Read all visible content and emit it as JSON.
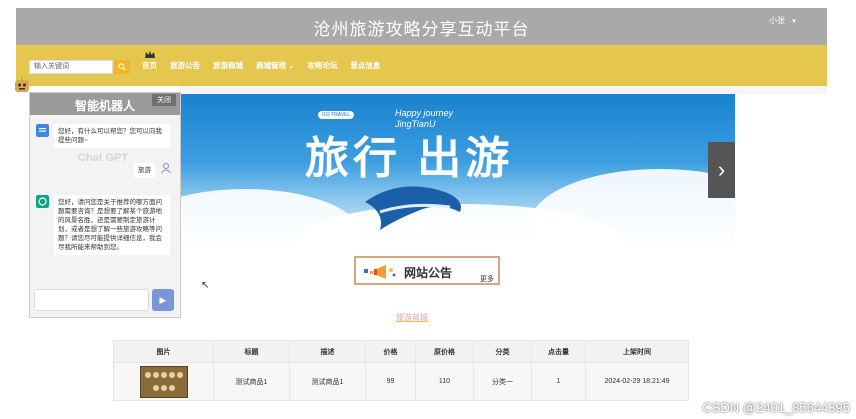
{
  "header": {
    "title": "沧州旅游攻略分享互动平台",
    "user": "小张"
  },
  "search": {
    "placeholder": "输入关键词"
  },
  "nav": {
    "items": [
      "首页",
      "旅游公告",
      "旅游商城",
      "商城管理",
      "攻略论坛",
      "景点信息"
    ]
  },
  "banner": {
    "slogan": "旅行 出游",
    "english": "Happy journey\nJingTianU",
    "tag": "GO TRAVEL"
  },
  "announcement": {
    "label": "网站公告",
    "more": "更多"
  },
  "section": {
    "title": "旅游商城"
  },
  "table": {
    "headers": [
      "图片",
      "标题",
      "描述",
      "价格",
      "原价格",
      "分类",
      "点击量",
      "上架时间"
    ],
    "rows": [
      [
        "",
        "测试商品1",
        "测试商品1",
        "99",
        "110",
        "分类一",
        "1",
        "2024-02-29 18:21:49"
      ]
    ]
  },
  "chat": {
    "title": "智能机器人",
    "close": "关闭",
    "watermark": "Chat GPT",
    "user_label": "旅游",
    "bot_greeting": "您好，有什么可以帮您？您可以向我提些问题~",
    "bot_reply": "您好，请问您是关于推荐的哪方面问题需要咨询？是想要了解某个旅游地的风景名胜，还是需要制定旅游计划，或者是想了解一些旅游攻略等问题？请您尽可能提供详细信息，我会尽我所能来帮助到您。",
    "input_value": ""
  },
  "footer": {
    "watermark": "CSDN @2401_85644395"
  },
  "colors": {
    "nav": "#e5c64f",
    "header": "#a9a9a9",
    "accent": "#f5b325"
  }
}
